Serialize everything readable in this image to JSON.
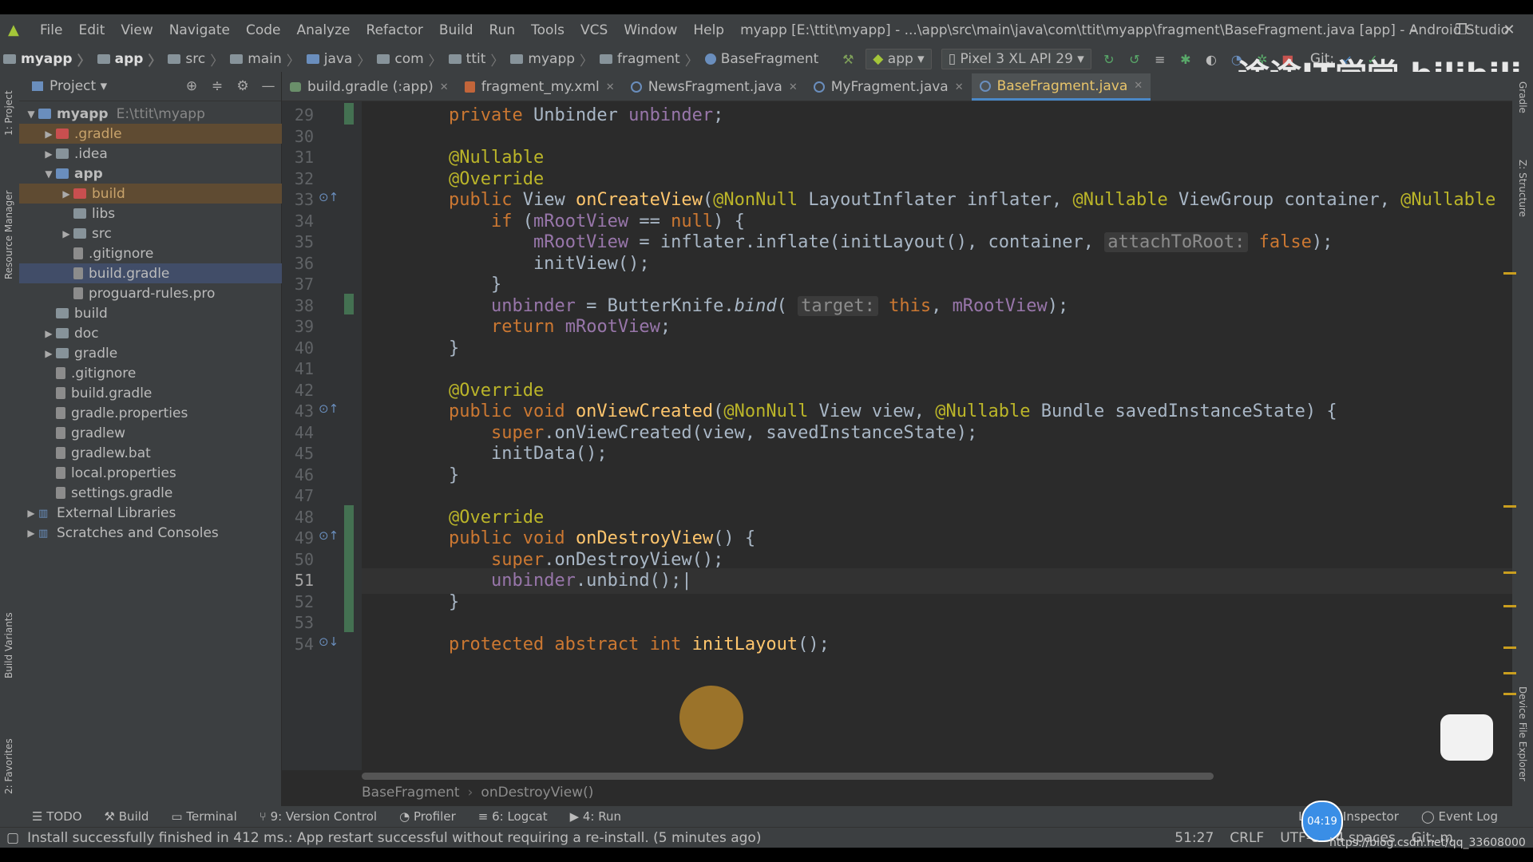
{
  "window": {
    "title": "myapp [E:\\ttit\\myapp] - ...\\app\\src\\main\\java\\com\\ttit\\myapp\\fragment\\BaseFragment.java [app] - Android Studio",
    "menu": [
      "File",
      "Edit",
      "View",
      "Navigate",
      "Code",
      "Analyze",
      "Refactor",
      "Build",
      "Run",
      "Tools",
      "VCS",
      "Window",
      "Help"
    ],
    "controls": {
      "minimize": "–",
      "restore": "❐",
      "close": "✕"
    }
  },
  "breadcrumbs": [
    "myapp",
    "app",
    "src",
    "main",
    "java",
    "com",
    "ttit",
    "myapp",
    "fragment",
    "BaseFragment"
  ],
  "toolbar": {
    "run_config": "app",
    "device": "Pixel 3 XL API 29",
    "git_label": "Git:"
  },
  "side_labels": {
    "left_top": "1: Project",
    "left_resource": "Resource Manager",
    "left_build_variants": "Build Variants",
    "left_favorites": "2: Favorites",
    "right_gradle": "Gradle",
    "right_structure": "Z: Structure",
    "right_device": "Device File Explorer"
  },
  "project_panel": {
    "header": "Project",
    "tree": [
      {
        "label": "myapp",
        "extra": "E:\\ttit\\myapp",
        "level": 0,
        "arrow": "▼",
        "icon": "folder-blue",
        "bold": true
      },
      {
        "label": ".gradle",
        "level": 1,
        "arrow": "▶",
        "icon": "folder-red",
        "hl": "brown"
      },
      {
        "label": ".idea",
        "level": 1,
        "arrow": "▶",
        "icon": "folder"
      },
      {
        "label": "app",
        "level": 1,
        "arrow": "▼",
        "icon": "folder-blue",
        "bold": true
      },
      {
        "label": "build",
        "level": 2,
        "arrow": "▶",
        "icon": "folder-red",
        "hl": "brown"
      },
      {
        "label": "libs",
        "level": 2,
        "arrow": "",
        "icon": "folder"
      },
      {
        "label": "src",
        "level": 2,
        "arrow": "▶",
        "icon": "folder"
      },
      {
        "label": ".gitignore",
        "level": 2,
        "arrow": "",
        "icon": "file"
      },
      {
        "label": "build.gradle",
        "level": 2,
        "arrow": "",
        "icon": "file",
        "hl": "blue"
      },
      {
        "label": "proguard-rules.pro",
        "level": 2,
        "arrow": "",
        "icon": "file"
      },
      {
        "label": "build",
        "level": 1,
        "arrow": "",
        "icon": "folder"
      },
      {
        "label": "doc",
        "level": 1,
        "arrow": "▶",
        "icon": "folder"
      },
      {
        "label": "gradle",
        "level": 1,
        "arrow": "▶",
        "icon": "folder"
      },
      {
        "label": ".gitignore",
        "level": 1,
        "arrow": "",
        "icon": "file"
      },
      {
        "label": "build.gradle",
        "level": 1,
        "arrow": "",
        "icon": "file"
      },
      {
        "label": "gradle.properties",
        "level": 1,
        "arrow": "",
        "icon": "file"
      },
      {
        "label": "gradlew",
        "level": 1,
        "arrow": "",
        "icon": "file"
      },
      {
        "label": "gradlew.bat",
        "level": 1,
        "arrow": "",
        "icon": "file"
      },
      {
        "label": "local.properties",
        "level": 1,
        "arrow": "",
        "icon": "file"
      },
      {
        "label": "settings.gradle",
        "level": 1,
        "arrow": "",
        "icon": "file"
      },
      {
        "label": "External Libraries",
        "level": 0,
        "arrow": "▶",
        "icon": "lib"
      },
      {
        "label": "Scratches and Consoles",
        "level": 0,
        "arrow": "▶",
        "icon": "lib"
      }
    ]
  },
  "tabs": [
    {
      "label": "build.gradle (:app)",
      "icon": "gradle"
    },
    {
      "label": "fragment_my.xml",
      "icon": "xml"
    },
    {
      "label": "NewsFragment.java",
      "icon": "class"
    },
    {
      "label": "MyFragment.java",
      "icon": "class"
    },
    {
      "label": "BaseFragment.java",
      "icon": "class",
      "active": true
    }
  ],
  "code_lines": [
    {
      "n": "29",
      "html": "    <span class='kw'>private</span> Unbinder <span class='fld'>unbinder</span>;"
    },
    {
      "n": "30",
      "html": ""
    },
    {
      "n": "31",
      "html": "    <span class='ann'>@Nullable</span>"
    },
    {
      "n": "32",
      "html": "    <span class='ann'>@Override</span>"
    },
    {
      "n": "33",
      "html": "    <span class='kw'>public</span> View <span class='mth'>onCreateView</span>(<span class='ann'>@NonNull</span> LayoutInflater inflater, <span class='ann'>@Nullable</span> ViewGroup container, <span class='ann'>@Nullable</span>"
    },
    {
      "n": "34",
      "html": "        <span class='kw'>if</span> (<span class='fld'>mRootView</span> == <span class='kw'>null</span>) {"
    },
    {
      "n": "35",
      "html": "            <span class='fld'>mRootView</span> = inflater.inflate(initLayout(), container, <span class='hint'>attachToRoot:</span> <span class='kw'>false</span>);"
    },
    {
      "n": "36",
      "html": "            initView();"
    },
    {
      "n": "37",
      "html": "        }"
    },
    {
      "n": "38",
      "html": "        <span class='fld'>unbinder</span> = ButterKnife.<i>bind</i>( <span class='hint'>target:</span> <span class='kw'>this</span>, <span class='fld'>mRootView</span>);"
    },
    {
      "n": "39",
      "html": "        <span class='kw'>return</span> <span class='fld'>mRootView</span>;"
    },
    {
      "n": "40",
      "html": "    }"
    },
    {
      "n": "41",
      "html": ""
    },
    {
      "n": "42",
      "html": "    <span class='ann'>@Override</span>"
    },
    {
      "n": "43",
      "html": "    <span class='kw'>public void</span> <span class='mth'>onViewCreated</span>(<span class='ann'>@NonNull</span> View view, <span class='ann'>@Nullable</span> Bundle savedInstanceState) {"
    },
    {
      "n": "44",
      "html": "        <span class='kw'>super</span>.onViewCreated(view, savedInstanceState);"
    },
    {
      "n": "45",
      "html": "        initData();"
    },
    {
      "n": "46",
      "html": "    }"
    },
    {
      "n": "47",
      "html": ""
    },
    {
      "n": "48",
      "html": "    <span class='ann'>@Override</span>"
    },
    {
      "n": "49",
      "html": "    <span class='kw'>public void</span> <span class='mth'>onDestroyView</span>() {"
    },
    {
      "n": "50",
      "html": "        <span class='kw'>super</span>.onDestroyView();"
    },
    {
      "n": "51",
      "html": "        <span class='fld'>unbinder</span>.unbind();|",
      "current": true
    },
    {
      "n": "52",
      "html": "    }"
    },
    {
      "n": "53",
      "html": ""
    },
    {
      "n": "54",
      "html": "    <span class='kw'>protected abstract int</span> <span class='mth'>initLayout</span>();"
    }
  ],
  "editor_breadcrumb": [
    "BaseFragment",
    "onDestroyView()"
  ],
  "tool_windows": [
    "TODO",
    "Build",
    "Terminal",
    "9: Version Control",
    "Profiler",
    "6: Logcat",
    "4: Run",
    "Layout Inspector",
    "Event Log"
  ],
  "status": {
    "message": "Install successfully finished in 412 ms.: App restart successful without requiring a re-install. (5 minutes ago)",
    "position": "51:27",
    "line_sep": "CRLF",
    "encoding": "UTF-8",
    "indent": "4 spaces",
    "git": "Git: m"
  },
  "overlay": {
    "timer": "04:19",
    "watermark": "途途IT学堂 bilibili",
    "url": "https://blog.csdn.net/qq_33608000"
  }
}
